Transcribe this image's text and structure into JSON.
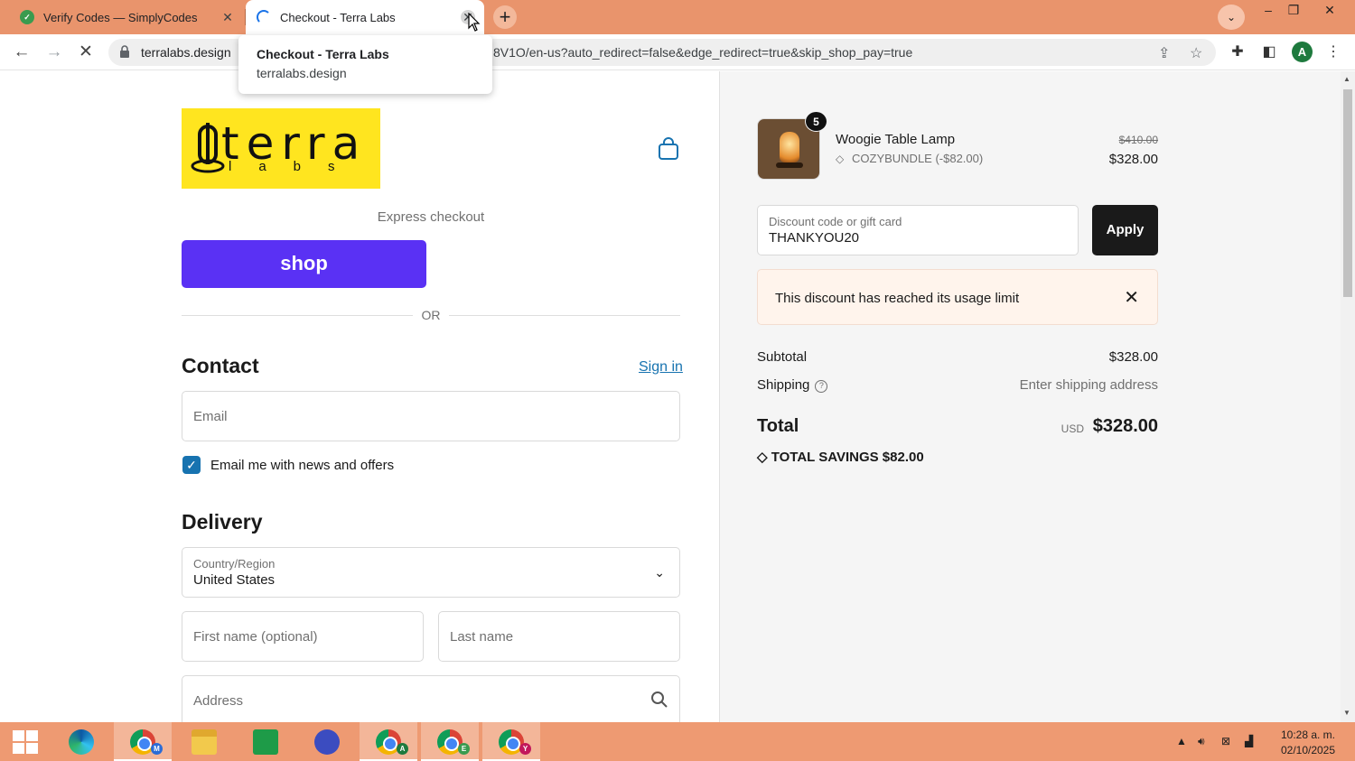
{
  "browser": {
    "tabs": [
      {
        "title": "Verify Codes — SimplyCodes"
      },
      {
        "title": "Checkout - Terra Labs"
      }
    ],
    "host": "terralabs.design",
    "path": "8V1O/en-us?auto_redirect=false&edge_redirect=true&skip_shop_pay=true",
    "profile_initial": "A",
    "hovercard": {
      "title": "Checkout - Terra Labs",
      "subtitle": "terralabs.design"
    }
  },
  "checkout": {
    "logo_line1": "terra",
    "logo_line2": "labs",
    "express_label": "Express checkout",
    "shop_button": "shop",
    "or_label": "OR",
    "contact_heading": "Contact",
    "sign_in": "Sign in",
    "email_placeholder": "Email",
    "newsletter_label": "Email me with news and offers",
    "delivery_heading": "Delivery",
    "country_label": "Country/Region",
    "country_value": "United States",
    "first_name_placeholder": "First name (optional)",
    "last_name_placeholder": "Last name",
    "address_placeholder": "Address"
  },
  "summary": {
    "item": {
      "quantity": "5",
      "name": "Woogie Table Lamp",
      "discount": "COZYBUNDLE (-$82.00)",
      "original_price": "$410.00",
      "price": "$328.00"
    },
    "discount_label": "Discount code or gift card",
    "discount_value": "THANKYOU20",
    "apply": "Apply",
    "alert": "This discount has reached its usage limit",
    "subtotal_label": "Subtotal",
    "subtotal_value": "$328.00",
    "shipping_label": "Shipping",
    "shipping_value": "Enter shipping address",
    "total_label": "Total",
    "currency": "USD",
    "total_value": "$328.00",
    "savings_label": "TOTAL SAVINGS",
    "savings_value": "$82.00"
  },
  "taskbar": {
    "badges": [
      "M",
      "A",
      "E",
      "Y"
    ],
    "time": "10:28 a. m.",
    "date": "02/10/2025"
  },
  "colors": {
    "shop_purple": "#5a31f4",
    "link_blue": "#1773b0",
    "logo_yellow": "#ffe51f",
    "browser_frame": "#e9946c"
  }
}
